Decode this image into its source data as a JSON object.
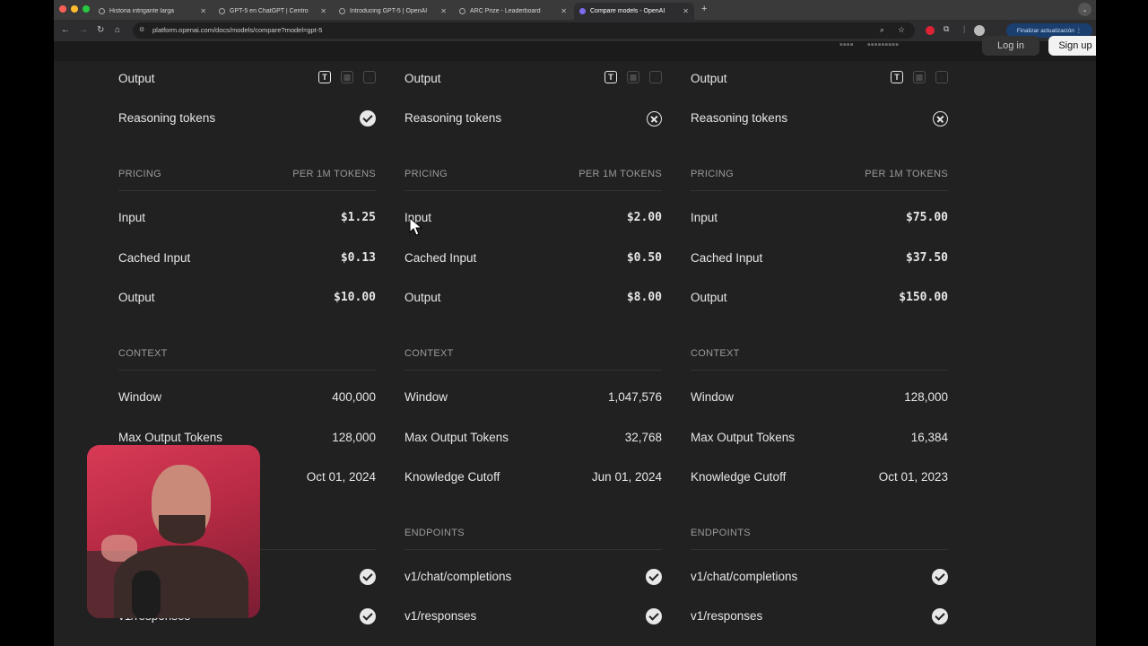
{
  "browser": {
    "tabs": [
      {
        "title": "Historia intrigante larga",
        "active": false
      },
      {
        "title": "GPT-5 en ChatGPT | Centro",
        "active": false
      },
      {
        "title": "Introducing GPT-5 | OpenAI",
        "active": false
      },
      {
        "title": "ARC Prize - Leaderboard",
        "active": false
      },
      {
        "title": "Compare models - OpenAI",
        "active": true
      }
    ],
    "url": "platform.openai.com/docs/models/compare?model=gpt-5",
    "update_button": "Finalizar actualización",
    "login_label": "Log in",
    "signup_label": "Sign up"
  },
  "labels": {
    "output": "Output",
    "reasoning_tokens": "Reasoning tokens",
    "pricing": "PRICING",
    "per_1m": "PER 1M TOKENS",
    "input": "Input",
    "cached_input": "Cached Input",
    "context": "CONTEXT",
    "window": "Window",
    "max_output_tokens": "Max Output Tokens",
    "knowledge_cutoff": "Knowledge Cutoff",
    "endpoints": "ENDPOINTS",
    "chat_completions": "v1/chat/completions",
    "responses": "v1/responses"
  },
  "models": [
    {
      "reasoning_tokens": true,
      "input_price": "$1.25",
      "cached_input_price": "$0.13",
      "output_price": "$10.00",
      "window": "400,000",
      "max_output_tokens": "128,000",
      "knowledge_cutoff": "Oct 01, 2024",
      "chat_completions": true,
      "responses": true
    },
    {
      "reasoning_tokens": false,
      "input_price": "$2.00",
      "cached_input_price": "$0.50",
      "output_price": "$8.00",
      "window": "1,047,576",
      "max_output_tokens": "32,768",
      "knowledge_cutoff": "Jun 01, 2024",
      "chat_completions": true,
      "responses": true
    },
    {
      "reasoning_tokens": false,
      "input_price": "$75.00",
      "cached_input_price": "$37.50",
      "output_price": "$150.00",
      "window": "128,000",
      "max_output_tokens": "16,384",
      "knowledge_cutoff": "Oct 01, 2023",
      "chat_completions": true,
      "responses": true
    }
  ]
}
